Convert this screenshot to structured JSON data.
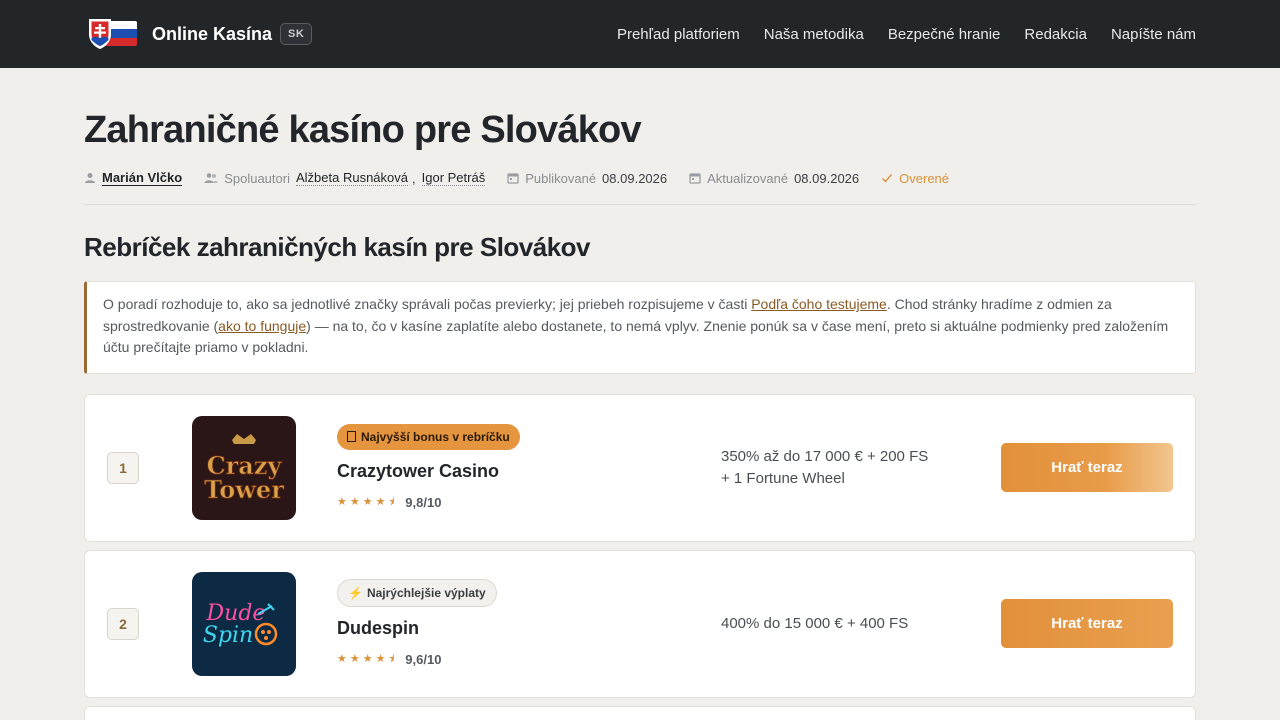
{
  "header": {
    "brand": "Online Kasína",
    "badge": "SK",
    "nav": [
      "Prehľad platforiem",
      "Naša metodika",
      "Bezpečné hranie",
      "Redakcia",
      "Napíšte nám"
    ],
    "flag_colors": [
      "#ffffff",
      "#1d4fb0",
      "#d72a2a"
    ]
  },
  "page": {
    "title": "Zahraničné kasíno pre Slovákov",
    "meta": {
      "author": "Marián Vlčko",
      "coauthors_label": "Spoluautori",
      "coauthors": [
        "Alžbeta Rusnáková",
        "Igor Petráš"
      ],
      "published_label": "Publikované",
      "published": "08.09.2026",
      "updated_label": "Aktualizované",
      "updated": "08.09.2026",
      "verified": "Overené"
    },
    "section_title": "Rebríček zahraničných kasín pre Slovákov",
    "note": {
      "p1": "O poradí rozhoduje to, ako sa jednotlivé značky správali počas previerky; jej priebeh rozpisujeme v časti ",
      "link1": "Podľa čoho testujeme",
      "p2": ". Chod stránky hradíme z odmien za sprostredkovanie (",
      "link2": "ako to funguje",
      "p3": ") — na to, čo v kasíne zaplatíte alebo dostanete, to nemá vplyv. Znenie ponúk sa v čase mení, preto si aktuálne podmienky pred založením účtu prečítajte priamo v pokladni."
    }
  },
  "casinos": [
    {
      "rank": "1",
      "tag": "Najvyšší bonus v rebríčku",
      "tag_icon": "gift-icon",
      "name": "Crazytower Casino",
      "stars": "★★★★⯨",
      "rating_value": 9.8,
      "score": "9,8/10",
      "bonus_line1": "350% až do 17 000 € + 200 FS",
      "bonus_line2": "+ 1 Fortune Wheel",
      "cta": "Hrať teraz",
      "logo_text": [
        "Crazy",
        "Tower"
      ]
    },
    {
      "rank": "2",
      "tag": "Najrýchlejšie výplaty",
      "tag_icon": "lightning-icon",
      "name": "Dudespin",
      "stars": "★★★★⯨",
      "rating_value": 9.6,
      "score": "9,6/10",
      "bonus_line1": "400% do 15 000 € + 400 FS",
      "cta": "Hrať teraz",
      "logo_text": [
        "Dude",
        "Spin"
      ]
    }
  ]
}
